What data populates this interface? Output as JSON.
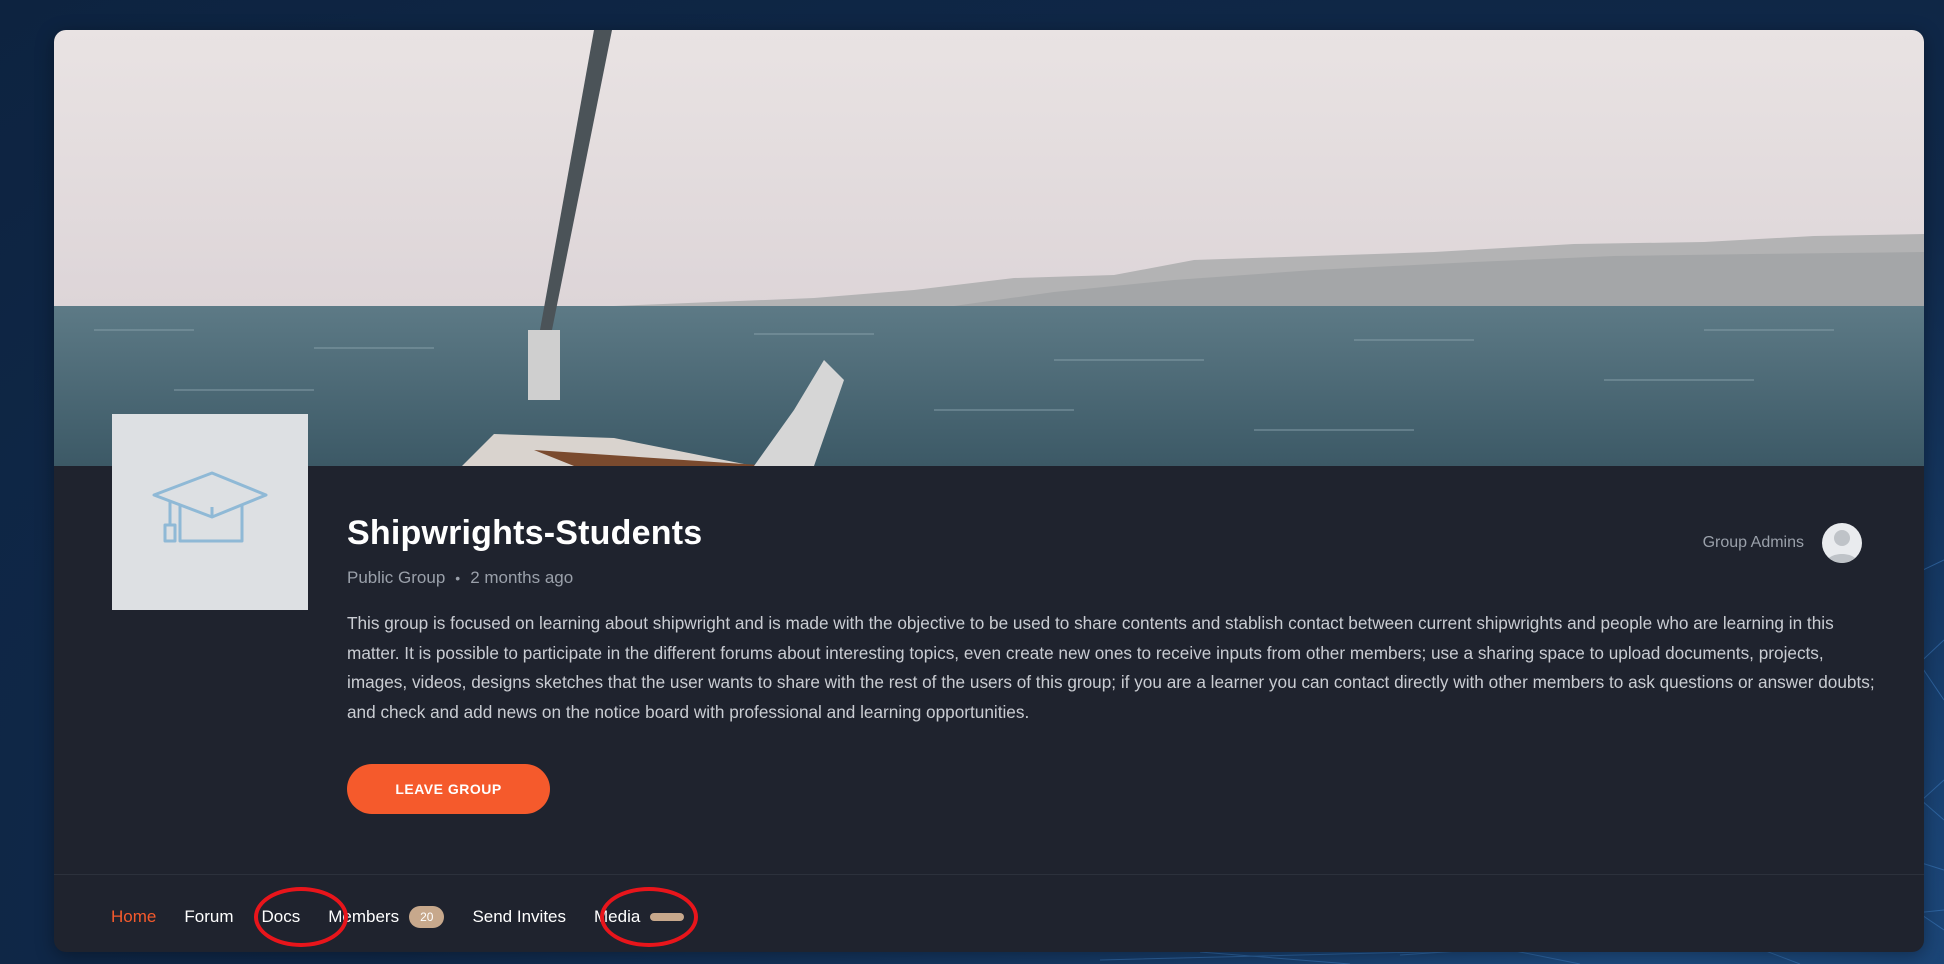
{
  "group": {
    "name": "Shipwrights-Students",
    "type": "Public Group",
    "separator": "•",
    "created": "2 months ago",
    "description": "This group is focused on learning about shipwright and is made with the objective to be used to share contents and stablish contact between current shipwrights and people who are learning in this matter. It is possible to participate in the different forums about interesting topics, even create new ones to receive inputs from other members; use a sharing space to upload documents, projects, images, videos, designs sketches that the user wants to share with the rest of the users of this group; if you are a learner you can contact directly with other members to ask questions or answer doubts; and check and add news on the notice board with professional and learning opportunities."
  },
  "actions": {
    "leave_label": "LEAVE GROUP"
  },
  "admins": {
    "label": "Group Admins"
  },
  "nav": {
    "items": [
      {
        "label": "Home",
        "active": true
      },
      {
        "label": "Forum"
      },
      {
        "label": "Docs"
      },
      {
        "label": "Members",
        "badge": "20"
      },
      {
        "label": "Send Invites"
      },
      {
        "label": "Media"
      }
    ]
  },
  "colors": {
    "accent": "#f55a2c",
    "card_bg": "#1f232e",
    "badge": "#c7a88c",
    "annotation": "#e8151b"
  },
  "icons": {
    "group_avatar": "graduation-cap-icon",
    "admin_avatar": "user-avatar-icon"
  }
}
